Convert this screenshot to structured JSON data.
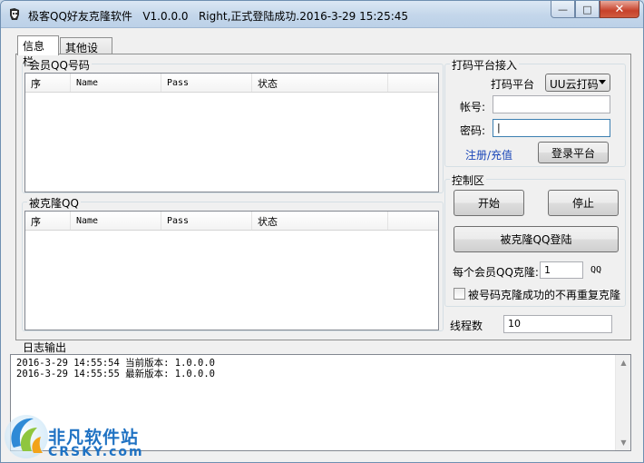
{
  "window": {
    "title": "极客QQ好友克隆软件   V1.0.0.0   Right,正式登陆成功.2016-3-29 15:25:45",
    "minimize_glyph": "—",
    "maximize_glyph": "□",
    "close_glyph": "✕"
  },
  "tabs": [
    {
      "label": "信息栏"
    },
    {
      "label": "其他设置"
    }
  ],
  "member_group": {
    "title": "会员QQ号码",
    "columns": [
      "序",
      "Name",
      "Pass",
      "状态"
    ]
  },
  "cloned_group": {
    "title": "被克隆QQ",
    "columns": [
      "序",
      "Name",
      "Pass",
      "状态"
    ]
  },
  "platform": {
    "title": "打码平台接入",
    "platform_label": "打码平台",
    "platform_value": "UU云打码",
    "account_label": "帐号:",
    "account_value": "",
    "password_label": "密码:",
    "password_value": "|",
    "register_link": "注册/充值",
    "login_button": "登录平台"
  },
  "control": {
    "title": "控制区",
    "start_button": "开始",
    "stop_button": "停止",
    "cloned_login_button": "被克隆QQ登陆",
    "per_member_label": "每个会员QQ克隆:",
    "per_member_value": "1",
    "per_member_unit": "QQ",
    "no_repeat_label": "被号码克隆成功的不再重复克隆",
    "no_repeat_checked": false
  },
  "threads": {
    "label": "线程数",
    "value": "10"
  },
  "log": {
    "title": "日志输出",
    "lines": [
      "2016-3-29 14:55:54 当前版本: 1.0.0.0",
      "2016-3-29 14:55:55 最新版本: 1.0.0.0"
    ]
  },
  "watermark": {
    "line1": "非凡软件站",
    "line2": "CRSKY.com"
  },
  "colors": {
    "accent": "#1f72c3",
    "link": "#1a46b8",
    "close_button": "#c7412a"
  }
}
